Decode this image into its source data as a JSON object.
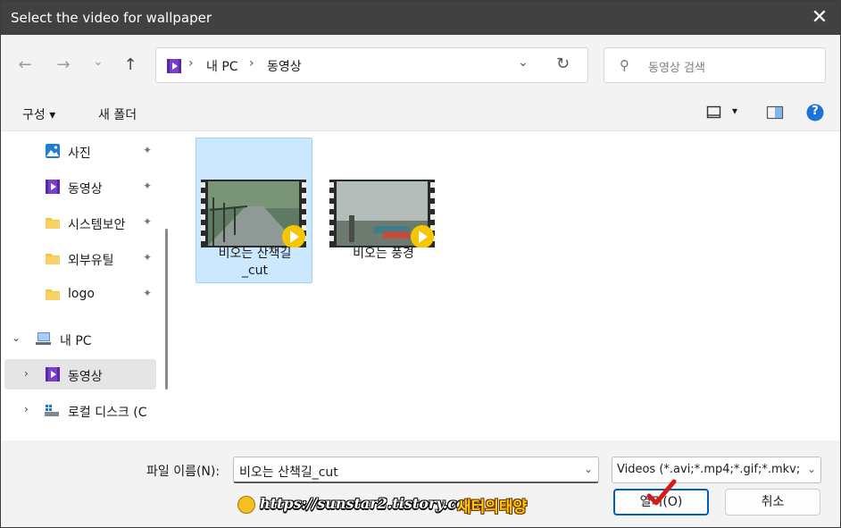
{
  "window": {
    "title": "Select the video for wallpaper",
    "close_glyph": "✕"
  },
  "nav": {
    "back_glyph": "←",
    "forward_glyph": "→",
    "recent_glyph": "⌄",
    "up_glyph": "↑"
  },
  "address": {
    "crumbs": [
      "내 PC",
      "동영상"
    ],
    "separator": "›",
    "dropdown_glyph": "⌄",
    "refresh_glyph": "↻"
  },
  "search": {
    "placeholder": "동영상 검색",
    "icon_glyph": "⚲"
  },
  "toolbar": {
    "organize_label": "구성 ▾",
    "new_folder_label": "새 폴더",
    "view_dropdown_glyph": "▾",
    "help_glyph": "?"
  },
  "sidebar": {
    "quick": [
      {
        "label": "사진",
        "icon": "photos-icon",
        "pinned": true
      },
      {
        "label": "동영상",
        "icon": "videos-icon",
        "pinned": true
      },
      {
        "label": "시스템보안",
        "icon": "folder-icon",
        "pinned": true
      },
      {
        "label": "외부유틸",
        "icon": "folder-icon",
        "pinned": true
      },
      {
        "label": "logo",
        "icon": "folder-icon",
        "pinned": true
      }
    ],
    "pin_glyph": "📌",
    "this_pc": {
      "label": "내 PC",
      "expanded": true,
      "chevron": "⌄"
    },
    "pc_children": [
      {
        "label": "동영상",
        "icon": "videos-icon",
        "selected": true,
        "chevron": "›"
      },
      {
        "label": "로컬 디스크 (C",
        "icon": "drive-icon",
        "chevron": "›"
      }
    ]
  },
  "files": [
    {
      "name_line1": "비오는 산책길",
      "name_line2": "_cut",
      "selected": true,
      "scene": "path"
    },
    {
      "name_line1": "비오는 풍경",
      "name_line2": "",
      "selected": false,
      "scene": "landscape"
    }
  ],
  "bottom": {
    "filename_label": "파일 이름(N):",
    "filename_value": "비오는 산책길_cut",
    "filename_dropdown_glyph": "⌄",
    "filetype_value": "Videos (*.avi;*.mp4;*.gif;*.mkv;",
    "filetype_dropdown_glyph": "⌄",
    "open_label": "열기(O)",
    "cancel_label": "취소"
  },
  "watermark": {
    "url": "https://sunstar2.tistory.com",
    "name": "새터의태양"
  },
  "colors": {
    "titlebar": "#414141",
    "selection": "#cce8ff",
    "accent": "#005fb8",
    "help": "#1e73d6",
    "folder": "#f5c542",
    "video_icon": "#7a3fd1"
  }
}
